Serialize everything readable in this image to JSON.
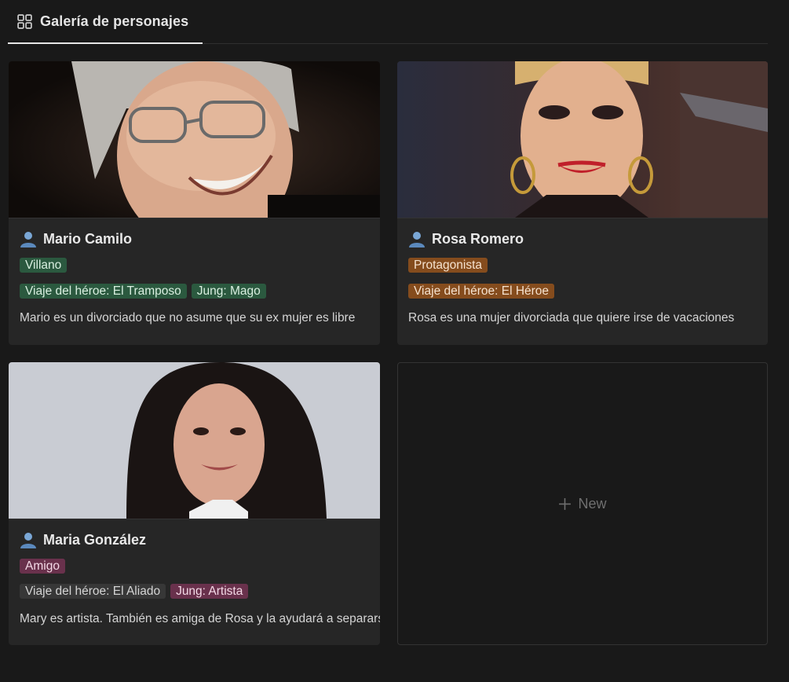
{
  "gallery": {
    "tab_label": "Galería de personajes",
    "tab_icon": "gallery-grid-icon"
  },
  "cards": [
    {
      "name": "Mario Camilo",
      "icon": "person-icon",
      "role": "Villano",
      "role_color": "green",
      "tags": [
        {
          "label": "Viaje del héroe: El Tramposo",
          "color": "green"
        },
        {
          "label": "Jung: Mago",
          "color": "green"
        }
      ],
      "description": "Mario es un divorciado que no asume que su ex mujer es libre"
    },
    {
      "name": "Rosa Romero",
      "icon": "person-icon",
      "role": "Protagonista",
      "role_color": "orange",
      "tags": [
        {
          "label": "Viaje del héroe: El Héroe",
          "color": "orange"
        }
      ],
      "description": "Rosa es una mujer divorciada que quiere irse de vacaciones"
    },
    {
      "name": "Maria González",
      "icon": "person-icon",
      "role": "Amigo",
      "role_color": "pink",
      "tags": [
        {
          "label": "Viaje del héroe: El Aliado",
          "color": "gray"
        },
        {
          "label": "Jung: Artista",
          "color": "pink"
        }
      ],
      "description": "Mary es artista. También es amiga de Rosa y la ayudará a separarse"
    }
  ],
  "new_card": {
    "label": "New",
    "icon": "plus-icon"
  },
  "colors": {
    "background": "#191919",
    "card": "#262626",
    "tag_green": "#2b593f",
    "tag_orange": "#854c1d",
    "tag_pink": "#69314c",
    "tag_gray": "#373737"
  }
}
